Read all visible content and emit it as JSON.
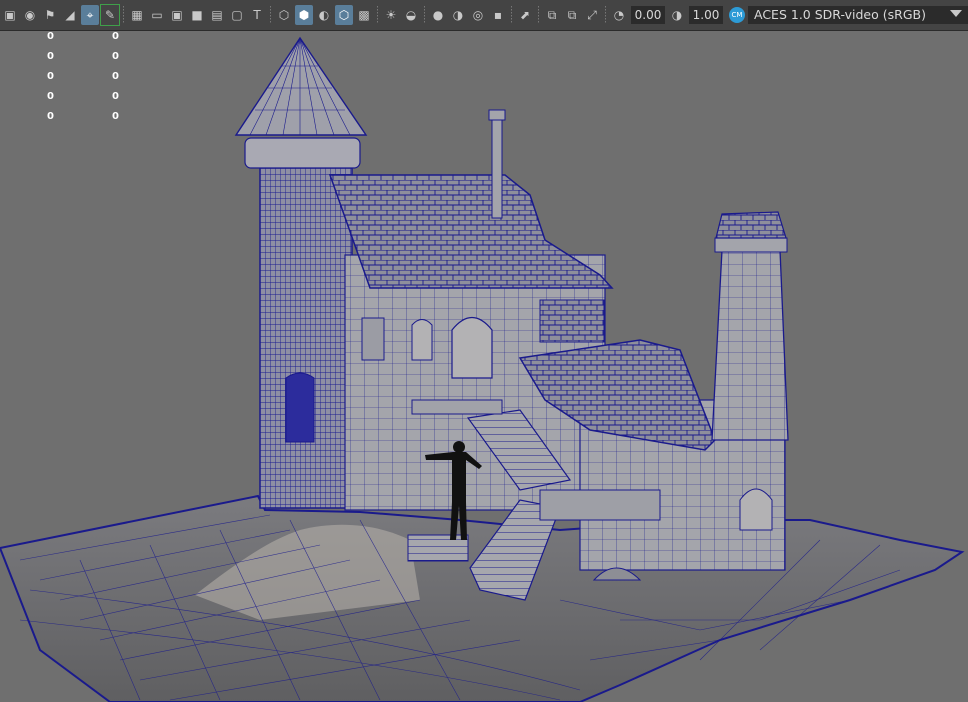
{
  "toolbar": {
    "exposure_value": "0.00",
    "gamma_value": "1.00",
    "color_space": "ACES 1.0 SDR-video (sRGB)",
    "color_management_badge": "CM",
    "icons": [
      "camera-icon",
      "camera-attributes-icon",
      "bookmark-icon",
      "image-plane-icon",
      "grid-icon",
      "film-gate-icon",
      "resolution-gate-icon",
      "gate-mask-icon",
      "field-chart-icon",
      "safe-action-icon",
      "safe-title-icon",
      "wireframe-icon",
      "smooth-shade-icon",
      "default-material-icon",
      "wireframe-on-shaded-icon",
      "xray-icon",
      "use-all-lights-icon",
      "shadows-icon",
      "screen-space-ao-icon",
      "motion-blur-icon",
      "multisample-aa-icon",
      "depth-of-field-icon",
      "isolate-select-icon",
      "xray-joints-icon",
      "xray-active-icon",
      "xray-component-icon",
      "exposure-icon",
      "gamma-icon",
      "color-management-icon"
    ]
  },
  "hud": {
    "rows": [
      {
        "a": "0",
        "b": "0"
      },
      {
        "a": "0",
        "b": "0"
      },
      {
        "a": "0",
        "b": "0"
      },
      {
        "a": "0",
        "b": "0"
      },
      {
        "a": "0",
        "b": "0"
      }
    ]
  },
  "viewport": {
    "background": "#6f6f6f",
    "wire_color": "#1a1a8c",
    "mesh_fill": "#a7a7ad",
    "character_color": "#111111"
  }
}
